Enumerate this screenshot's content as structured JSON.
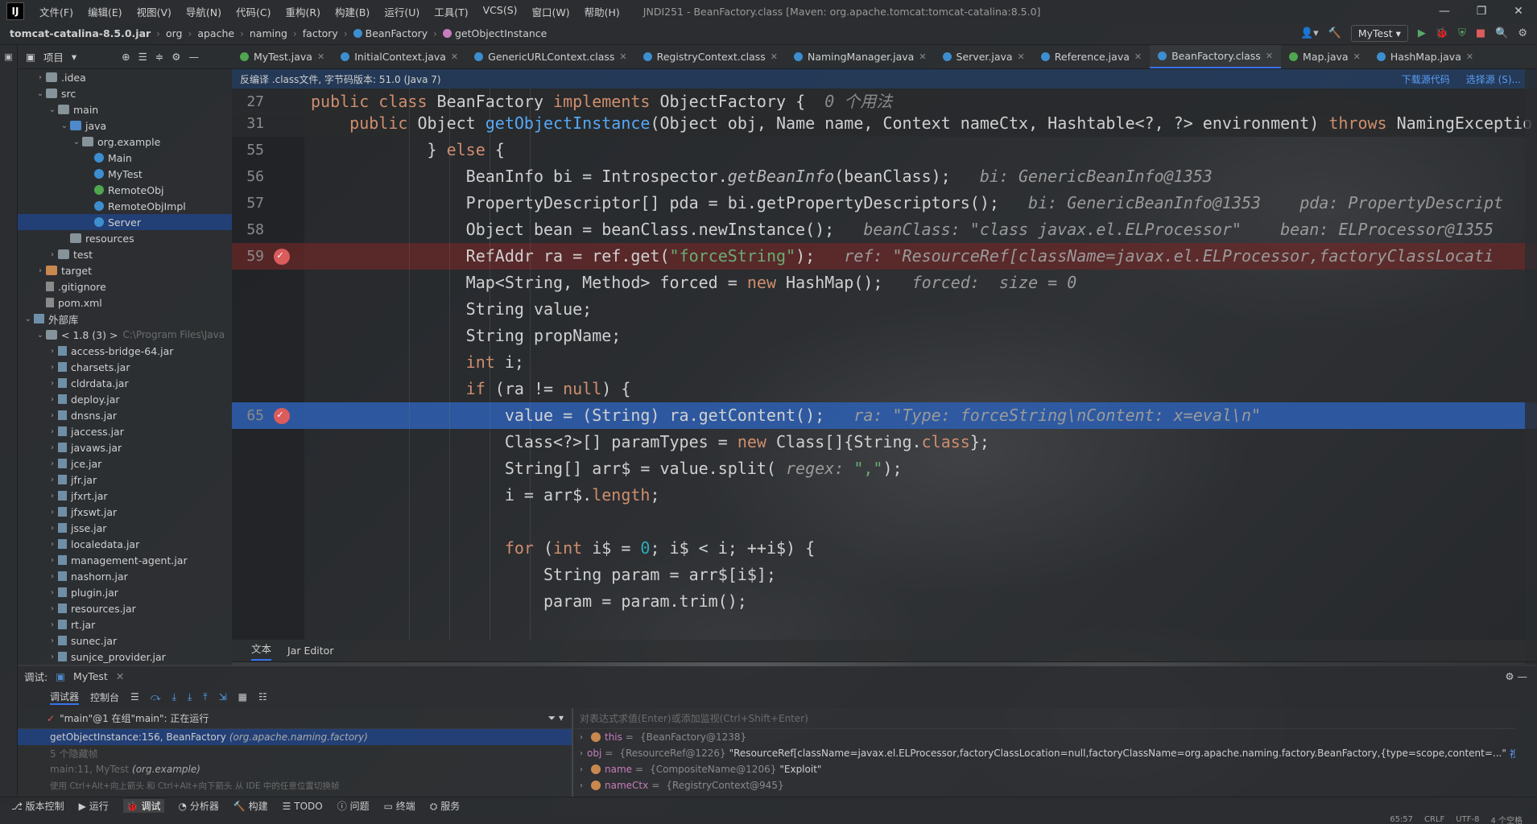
{
  "menubar": {
    "logo": "IJ",
    "items": [
      "文件(F)",
      "编辑(E)",
      "视图(V)",
      "导航(N)",
      "代码(C)",
      "重构(R)",
      "构建(B)",
      "运行(U)",
      "工具(T)",
      "VCS(S)",
      "窗口(W)",
      "帮助(H)"
    ],
    "window_title": "JNDI251 - BeanFactory.class [Maven: org.apache.tomcat:tomcat-catalina:8.5.0]"
  },
  "navbar": {
    "crumbs": [
      "tomcat-catalina-8.5.0.jar",
      "org",
      "apache",
      "naming",
      "factory",
      "BeanFactory",
      "getObjectInstance"
    ],
    "run_config": "MyTest"
  },
  "project_panel": {
    "title": "项目",
    "rows": [
      {
        "indent": 1,
        "arrow": "›",
        "icon": "folder",
        "label": ".idea"
      },
      {
        "indent": 1,
        "arrow": "⌄",
        "icon": "folder",
        "label": "src"
      },
      {
        "indent": 2,
        "arrow": "⌄",
        "icon": "folder",
        "label": "main"
      },
      {
        "indent": 3,
        "arrow": "⌄",
        "icon": "folder-blue",
        "label": "java"
      },
      {
        "indent": 4,
        "arrow": "⌄",
        "icon": "folder",
        "label": "org.example"
      },
      {
        "indent": 5,
        "arrow": "",
        "icon": "class",
        "label": "Main"
      },
      {
        "indent": 5,
        "arrow": "",
        "icon": "class",
        "label": "MyTest"
      },
      {
        "indent": 5,
        "arrow": "",
        "icon": "iface",
        "label": "RemoteObj"
      },
      {
        "indent": 5,
        "arrow": "",
        "icon": "class",
        "label": "RemoteObjImpl"
      },
      {
        "indent": 5,
        "arrow": "",
        "icon": "class",
        "label": "Server",
        "selected": true
      },
      {
        "indent": 3,
        "arrow": "",
        "icon": "folder",
        "label": "resources"
      },
      {
        "indent": 2,
        "arrow": "›",
        "icon": "folder",
        "label": "test"
      },
      {
        "indent": 1,
        "arrow": "›",
        "icon": "folder-orange",
        "label": "target"
      },
      {
        "indent": 1,
        "arrow": "",
        "icon": "file",
        "label": ".gitignore"
      },
      {
        "indent": 1,
        "arrow": "",
        "icon": "file",
        "label": "pom.xml"
      },
      {
        "indent": 0,
        "arrow": "⌄",
        "icon": "lib",
        "label": "外部库"
      },
      {
        "indent": 1,
        "arrow": "⌄",
        "icon": "folder",
        "label": "< 1.8 (3) >",
        "dim": "C:\\Program Files\\Java"
      },
      {
        "indent": 2,
        "arrow": "›",
        "icon": "jar",
        "label": "access-bridge-64.jar"
      },
      {
        "indent": 2,
        "arrow": "›",
        "icon": "jar",
        "label": "charsets.jar"
      },
      {
        "indent": 2,
        "arrow": "›",
        "icon": "jar",
        "label": "cldrdata.jar"
      },
      {
        "indent": 2,
        "arrow": "›",
        "icon": "jar",
        "label": "deploy.jar"
      },
      {
        "indent": 2,
        "arrow": "›",
        "icon": "jar",
        "label": "dnsns.jar"
      },
      {
        "indent": 2,
        "arrow": "›",
        "icon": "jar",
        "label": "jaccess.jar"
      },
      {
        "indent": 2,
        "arrow": "›",
        "icon": "jar",
        "label": "javaws.jar"
      },
      {
        "indent": 2,
        "arrow": "›",
        "icon": "jar",
        "label": "jce.jar"
      },
      {
        "indent": 2,
        "arrow": "›",
        "icon": "jar",
        "label": "jfr.jar"
      },
      {
        "indent": 2,
        "arrow": "›",
        "icon": "jar",
        "label": "jfxrt.jar"
      },
      {
        "indent": 2,
        "arrow": "›",
        "icon": "jar",
        "label": "jfxswt.jar"
      },
      {
        "indent": 2,
        "arrow": "›",
        "icon": "jar",
        "label": "jsse.jar"
      },
      {
        "indent": 2,
        "arrow": "›",
        "icon": "jar",
        "label": "localedata.jar"
      },
      {
        "indent": 2,
        "arrow": "›",
        "icon": "jar",
        "label": "management-agent.jar"
      },
      {
        "indent": 2,
        "arrow": "›",
        "icon": "jar",
        "label": "nashorn.jar"
      },
      {
        "indent": 2,
        "arrow": "›",
        "icon": "jar",
        "label": "plugin.jar"
      },
      {
        "indent": 2,
        "arrow": "›",
        "icon": "jar",
        "label": "resources.jar"
      },
      {
        "indent": 2,
        "arrow": "›",
        "icon": "jar",
        "label": "rt.jar"
      },
      {
        "indent": 2,
        "arrow": "›",
        "icon": "jar",
        "label": "sunec.jar"
      },
      {
        "indent": 2,
        "arrow": "›",
        "icon": "jar",
        "label": "sunjce_provider.jar"
      }
    ]
  },
  "tabs": [
    {
      "label": "MyTest.java",
      "icon": "#4fa64f"
    },
    {
      "label": "InitialContext.java",
      "icon": "#3d8ecf"
    },
    {
      "label": "GenericURLContext.class",
      "icon": "#3d8ecf"
    },
    {
      "label": "RegistryContext.class",
      "icon": "#3d8ecf"
    },
    {
      "label": "NamingManager.java",
      "icon": "#3d8ecf"
    },
    {
      "label": "Server.java",
      "icon": "#3d8ecf"
    },
    {
      "label": "Reference.java",
      "icon": "#3d8ecf"
    },
    {
      "label": "BeanFactory.class",
      "icon": "#3d8ecf",
      "active": true
    },
    {
      "label": "Map.java",
      "icon": "#4fa64f"
    },
    {
      "label": "HashMap.java",
      "icon": "#3d8ecf"
    }
  ],
  "banner": {
    "text": "反编译 .class文件, 字节码版本: 51.0 (Java 7)",
    "download_link": "下载源代码",
    "choose_link": "选择源 (S)..."
  },
  "code_lines": [
    {
      "ln": "27",
      "kind": "sticky",
      "html": "<span class='kw'>public class </span><span class='plain'>BeanFactory </span><span class='kw'>implements </span><span class='plain'>ObjectFactory {  </span><span class='cm'>0 个用法</span>"
    },
    {
      "ln": "31",
      "kind": "sticky",
      "html": "<span class='plain'>    </span><span class='kw'>public </span><span class='plain'>Object </span><span class='fn'>getObjectInstance</span><span class='plain'>(Object obj, Name name, Context nameCtx, Hashtable&lt;?, ?&gt; environment) </span><span class='kw'>throws </span><span class='plain'>NamingExceptio</span>"
    },
    {
      "ln": "55",
      "kind": "",
      "html": "<span class='plain'>            } </span><span class='kw'>else </span><span class='plain'>{</span>"
    },
    {
      "ln": "56",
      "kind": "",
      "html": "<span class='plain'>                BeanInfo bi = Introspector.</span><span class='it'>getBeanInfo</span><span class='plain'>(beanClass);   </span><span class='hint'>bi: GenericBeanInfo@1353</span>"
    },
    {
      "ln": "57",
      "kind": "",
      "html": "<span class='plain'>                PropertyDescriptor[] pda = bi.getPropertyDescriptors();   </span><span class='hint'>bi: GenericBeanInfo@1353    pda: PropertyDescript</span>"
    },
    {
      "ln": "58",
      "kind": "",
      "html": "<span class='plain'>                Object bean = beanClass.newInstance();   </span><span class='hint'>beanClass: \"class javax.el.ELProcessor\"    bean: ELProcessor@1355</span>"
    },
    {
      "ln": "59",
      "kind": "bp",
      "html": "<span class='plain'>                RefAddr ra = ref.get(</span><span class='str'>\"forceString\"</span><span class='plain'>);   </span><span class='hint'>ref: \"ResourceRef[className=javax.el.ELProcessor,factoryClassLocati</span>"
    },
    {
      "ln": "",
      "kind": "",
      "html": "<span class='plain'>                Map&lt;String, Method&gt; forced = </span><span class='kw'>new </span><span class='plain'>HashMap();   </span><span class='hint'>forced:  size = 0</span>"
    },
    {
      "ln": "",
      "kind": "",
      "html": "<span class='plain'>                String value;</span>"
    },
    {
      "ln": "",
      "kind": "",
      "html": "<span class='plain'>                String propName;</span>"
    },
    {
      "ln": "",
      "kind": "",
      "html": "<span class='kw'>                int </span><span class='plain'>i;</span>"
    },
    {
      "ln": "",
      "kind": "",
      "html": "<span class='kw'>                if </span><span class='plain'>(ra != </span><span class='kw'>null</span><span class='plain'>) {</span>"
    },
    {
      "ln": "65",
      "kind": "cur",
      "html": "<span class='plain'>                    value = (String) ra.getContent();   </span><span class='hint'>ra: \"Type: forceString\\nContent: x=eval\\n\"</span>"
    },
    {
      "ln": "",
      "kind": "",
      "html": "<span class='plain'>                    Class&lt;?&gt;[] paramTypes = </span><span class='kw'>new </span><span class='plain'>Class[]{String.</span><span class='kw'>class</span><span class='plain'>};</span>"
    },
    {
      "ln": "",
      "kind": "",
      "html": "<span class='plain'>                    String[] arr$ = value.split( </span><span class='hint'>regex: </span><span class='str'>\",\"</span><span class='plain'>);</span>"
    },
    {
      "ln": "",
      "kind": "",
      "html": "<span class='plain'>                    i = arr$.</span><span class='kw'>length</span><span class='plain'>;</span>"
    },
    {
      "ln": "",
      "kind": "",
      "html": ""
    },
    {
      "ln": "",
      "kind": "",
      "html": "<span class='kw'>                    for </span><span class='plain'>(</span><span class='kw'>int </span><span class='plain'>i$ = </span><span class='num'>0</span><span class='plain'>; i$ &lt; i; ++i$) {</span>"
    },
    {
      "ln": "",
      "kind": "",
      "html": "<span class='plain'>                        String param = arr$[i$];</span>"
    },
    {
      "ln": "",
      "kind": "",
      "html": "<span class='plain'>                        param = param.trim();</span>"
    }
  ],
  "editor_bottom_tabs": [
    "文本",
    "Jar Editor"
  ],
  "debug": {
    "label": "调试:",
    "config": "MyTest",
    "tabs": [
      "调试器",
      "控制台"
    ],
    "thread": "\"main\"@1 在组\"main\": 正在运行",
    "frames": [
      {
        "text": "getObjectInstance:156, BeanFactory",
        "pkg": "(org.apache.naming.factory)",
        "selected": true
      },
      {
        "text": "5 个隐藏帧",
        "pkg": "",
        "dim": true
      },
      {
        "text": "main:11, MyTest",
        "pkg": "(org.example)",
        "dim": true
      }
    ],
    "hint": "使用 Ctrl+Alt+向上箭头 和 Ctrl+Alt+向下箭头 从 IDE 中的任意位置切换帧",
    "eval_placeholder": "对表达式求值(Enter)或添加监视(Ctrl+Shift+Enter)",
    "vars": [
      {
        "name": "this",
        "type": "{BeanFactory@1238}",
        "value": ""
      },
      {
        "name": "obj",
        "type": "{ResourceRef@1226}",
        "value": "\"ResourceRef[className=javax.el.ELProcessor,factoryClassLocation=null,factoryClassName=org.apache.naming.factory.BeanFactory,{type=scope,content=...\"",
        "link": "视图"
      },
      {
        "name": "name",
        "type": "{CompositeName@1206}",
        "value": "\"Exploit\""
      },
      {
        "name": "nameCtx",
        "type": "{RegistryContext@945}",
        "value": ""
      }
    ]
  },
  "bottom_tools": [
    "版本控制",
    "运行",
    "调试",
    "分析器",
    "构建",
    "TODO",
    "问题",
    "终端",
    "服务"
  ],
  "status": {
    "position": "65:57",
    "line_sep": "CRLF",
    "encoding": "UTF-8",
    "indent": "4 个空格"
  }
}
